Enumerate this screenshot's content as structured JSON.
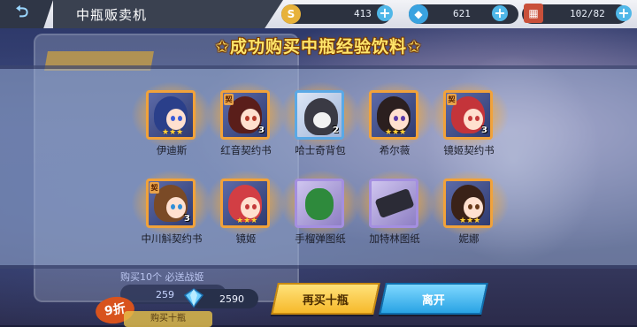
{
  "header": {
    "title": "中瓶贩卖机",
    "resources": [
      {
        "icon": "gold-coin-icon",
        "value": "413"
      },
      {
        "icon": "diamond-icon",
        "value": "621"
      },
      {
        "icon": "stamina-box-icon",
        "value": "102/82"
      }
    ]
  },
  "headline": "成功购买中瓶经验饮料",
  "rewards": [
    {
      "name": "伊迪斯",
      "kind": "character",
      "stars": "★★★"
    },
    {
      "name": "红音契约书",
      "kind": "contract",
      "count": "3"
    },
    {
      "name": "哈士奇背包",
      "kind": "backpack",
      "count": "2"
    },
    {
      "name": "希尔薇",
      "kind": "character",
      "stars": "★★★"
    },
    {
      "name": "镜姬契约书",
      "kind": "contract",
      "count": "3"
    },
    {
      "name": "中川斛契约书",
      "kind": "contract",
      "count": "3"
    },
    {
      "name": "镜姬",
      "kind": "character",
      "stars": "★★★"
    },
    {
      "name": "手榴弹图纸",
      "kind": "blueprint"
    },
    {
      "name": "加特林图纸",
      "kind": "blueprint"
    },
    {
      "name": "妮娜",
      "kind": "character",
      "stars": "★★★"
    }
  ],
  "background": {
    "promo_text": "购买10个 必送战姬",
    "discount": "9折",
    "price_hint": "259",
    "buy_label": "购买十瓶"
  },
  "footer": {
    "diamond_balance": "2590",
    "buy_again_label": "再买十瓶",
    "leave_label": "离开"
  },
  "colors": {
    "accent_gold": "#ffe56a",
    "button_yellow": "#f6b92b",
    "button_blue": "#29a3e4"
  }
}
